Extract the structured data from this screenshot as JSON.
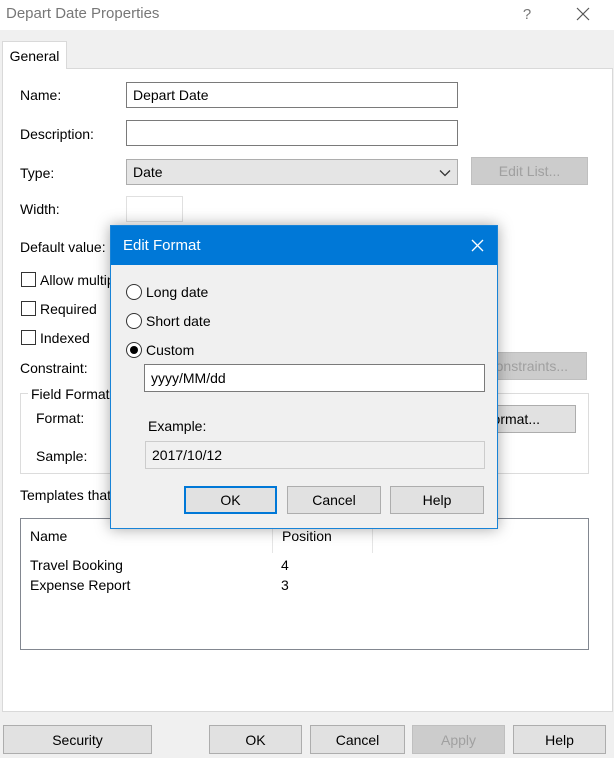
{
  "window": {
    "title": "Depart Date Properties",
    "help_glyph": "?",
    "icons": [
      "help-icon",
      "close-icon"
    ]
  },
  "tabs": [
    {
      "label": "General",
      "selected": true
    }
  ],
  "form": {
    "name_label": "Name:",
    "name_value": "Depart Date",
    "description_label": "Description:",
    "description_value": "",
    "type_label": "Type:",
    "type_value": "Date",
    "edit_list_button": "Edit List...",
    "width_label": "Width:",
    "width_value": "",
    "default_value_label": "Default value:",
    "allow_multiple_label": "Allow multipl",
    "required_label": "Required",
    "indexed_label": "Indexed",
    "constraint_label": "Constraint:",
    "constraints_button": "onstraints...",
    "field_format_title": "Field Format",
    "format_label": "Format:",
    "format_button": "ormat...",
    "sample_label": "Sample:",
    "templates_label": "Templates that"
  },
  "templates_table": {
    "columns": [
      "Name",
      "Position"
    ],
    "rows": [
      {
        "name": "Travel Booking",
        "position": "4"
      },
      {
        "name": "Expense Report",
        "position": "3"
      }
    ]
  },
  "footer": {
    "security": "Security",
    "ok": "OK",
    "cancel": "Cancel",
    "apply": "Apply",
    "help": "Help"
  },
  "modal": {
    "title": "Edit Format",
    "options": [
      "Long date",
      "Short date",
      "Custom"
    ],
    "selected_option": "Custom",
    "custom_value": "yyyy/MM/dd",
    "example_label": "Example:",
    "example_value": "2017/10/12",
    "ok": "OK",
    "cancel": "Cancel",
    "help": "Help"
  },
  "colors": {
    "accent": "#0078d7",
    "window_bg": "#f0f0f0",
    "panel_bg": "#ffffff",
    "disabled_text": "#a0a0a0"
  }
}
